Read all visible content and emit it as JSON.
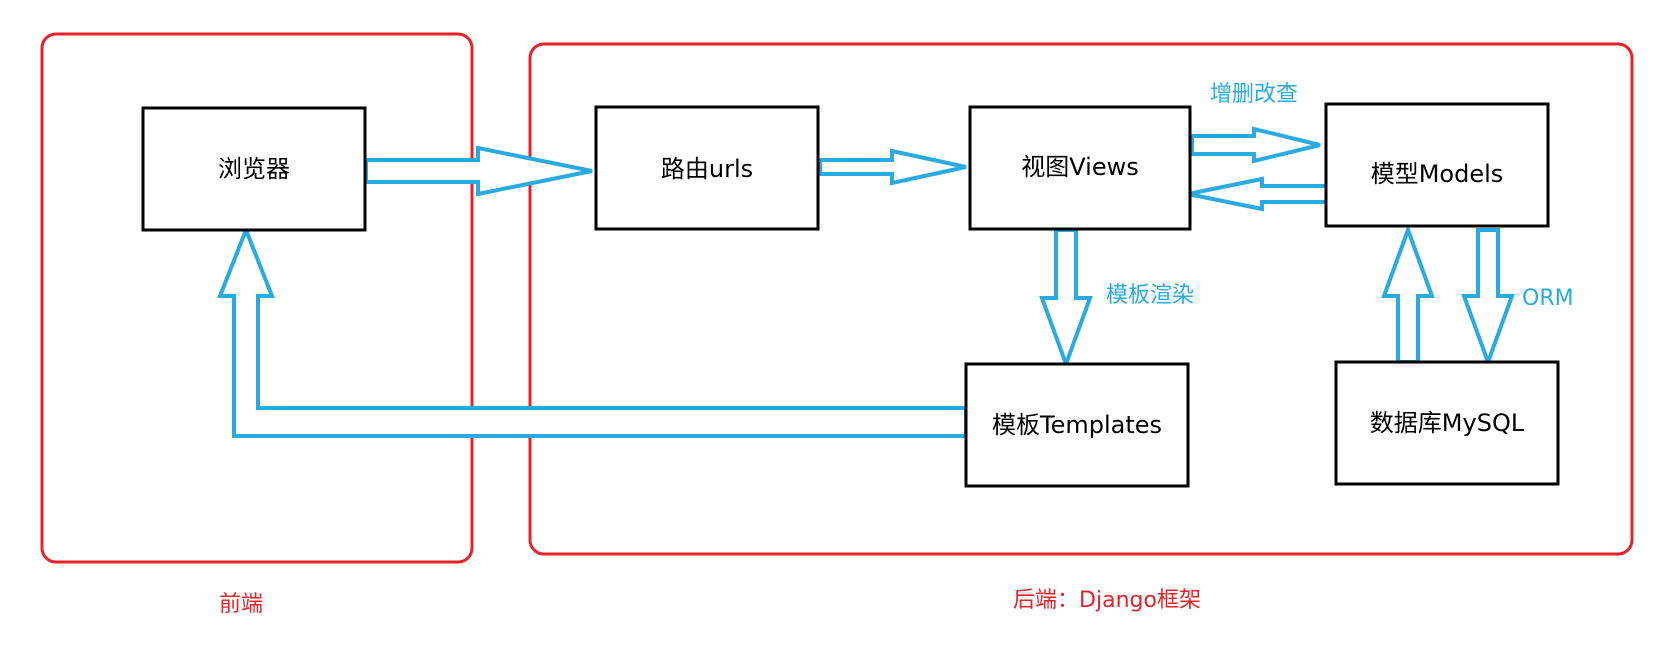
{
  "colors": {
    "group_border": "#e8222a",
    "group_label": "#e8222a",
    "arrow": "#29abe2",
    "edge_label": "#29abe2",
    "node_border": "#000000"
  },
  "groups": {
    "frontend": {
      "label": "前端"
    },
    "backend": {
      "label": "后端：Django框架"
    }
  },
  "nodes": {
    "browser": {
      "label": "浏览器"
    },
    "urls": {
      "label": "路由urls"
    },
    "views": {
      "label": "视图Views"
    },
    "models": {
      "label": "模型Models"
    },
    "templates": {
      "label": "模板Templates"
    },
    "mysql": {
      "label": "数据库MySQL"
    }
  },
  "edges": {
    "crud": {
      "label": "增删改查"
    },
    "render": {
      "label": "模板渲染"
    },
    "orm": {
      "label": "ORM"
    }
  }
}
